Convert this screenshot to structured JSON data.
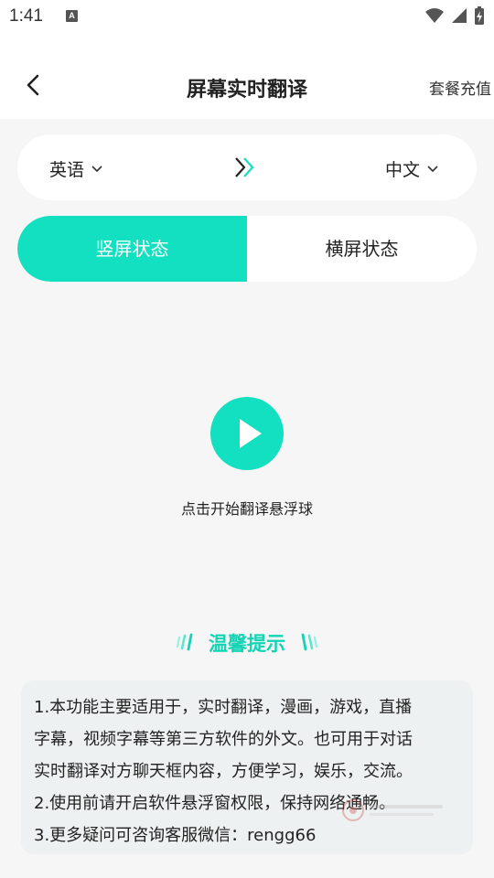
{
  "status_bar": {
    "time": "1:41",
    "notification_icon": "A"
  },
  "app_bar": {
    "title": "屏幕实时翻译",
    "action_label": "套餐充值"
  },
  "language_bar": {
    "source_language": "英语",
    "target_language": "中文"
  },
  "mode_tabs": [
    {
      "label": "竖屏状态",
      "selected": true
    },
    {
      "label": "横屏状态",
      "selected": false
    }
  ],
  "play": {
    "caption": "点击开始翻译悬浮球"
  },
  "tips": {
    "title": "温馨提示",
    "lines": [
      "1.本功能主要适用于，实时翻译，漫画，游戏，直播",
      "字幕，视频字幕等第三方软件的外文。也可用于对话",
      "实时翻译对方聊天框内容，方便学习，娱乐，交流。",
      "2.使用前请开启软件悬浮窗权限，保持网络通畅。",
      "3.更多疑问可咨询客服微信：rengg66"
    ]
  },
  "colors": {
    "accent": "#12e0c0",
    "tips_title": "#12d4b4",
    "background": "#f6f6f6"
  }
}
